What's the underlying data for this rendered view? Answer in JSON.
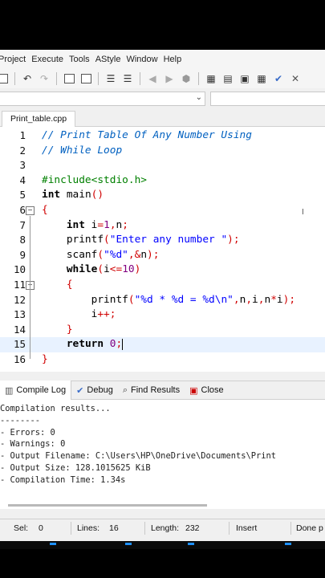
{
  "menu": [
    "Project",
    "Execute",
    "Tools",
    "AStyle",
    "Window",
    "Help"
  ],
  "toolbar_icons": [
    "compile-icon",
    "undo-icon",
    "redo-icon",
    "zoom-in-icon",
    "zoom-out-icon",
    "indent-icon",
    "unindent-icon",
    "back-icon",
    "forward-icon",
    "stop-icon",
    "grid-icon",
    "layout-icon",
    "window-icon",
    "tile-icon",
    "check-icon",
    "close-all-icon"
  ],
  "file_tab": "Print_table.cpp",
  "code_lines": [
    {
      "n": "1",
      "text": "// Print Table Of Any Number Using",
      "type": "comment"
    },
    {
      "n": "2",
      "text": "// While Loop",
      "type": "comment"
    },
    {
      "n": "3",
      "text": "",
      "type": "plain"
    },
    {
      "n": "4",
      "text": "#include<stdio.h>",
      "type": "pre"
    },
    {
      "n": "5",
      "text": "int main()",
      "type": "plain"
    },
    {
      "n": "6",
      "text": "{",
      "type": "brace"
    },
    {
      "n": "7",
      "text": "    int i=1,n;",
      "type": "plain"
    },
    {
      "n": "8",
      "text": "    printf(\"Enter any number \");",
      "type": "plain"
    },
    {
      "n": "9",
      "text": "    scanf(\"%d\",&n);",
      "type": "plain"
    },
    {
      "n": "10",
      "text": "    while(i<=10)",
      "type": "plain"
    },
    {
      "n": "11",
      "text": "    {",
      "type": "brace"
    },
    {
      "n": "12",
      "text": "        printf(\"%d * %d = %d\\n\",n,i,n*i);",
      "type": "plain"
    },
    {
      "n": "13",
      "text": "        i++;",
      "type": "plain"
    },
    {
      "n": "14",
      "text": "    }",
      "type": "brace"
    },
    {
      "n": "15",
      "text": "    return 0;",
      "type": "plain"
    },
    {
      "n": "16",
      "text": "}",
      "type": "brace"
    }
  ],
  "bottom_tabs": {
    "compile_log": "Compile Log",
    "debug": "Debug",
    "find_results": "Find Results",
    "close": "Close"
  },
  "log_lines": [
    "Compilation results...",
    "--------",
    "- Errors: 0",
    "- Warnings: 0",
    "- Output Filename: C:\\Users\\HP\\OneDrive\\Documents\\Print",
    "- Output Size: 128.1015625 KiB",
    "- Compilation Time: 1.34s"
  ],
  "status": {
    "sel_label": "Sel:",
    "sel_value": "0",
    "lines_label": "Lines:",
    "lines_value": "16",
    "length_label": "Length:",
    "length_value": "232",
    "mode": "Insert",
    "parse": "Done p"
  }
}
